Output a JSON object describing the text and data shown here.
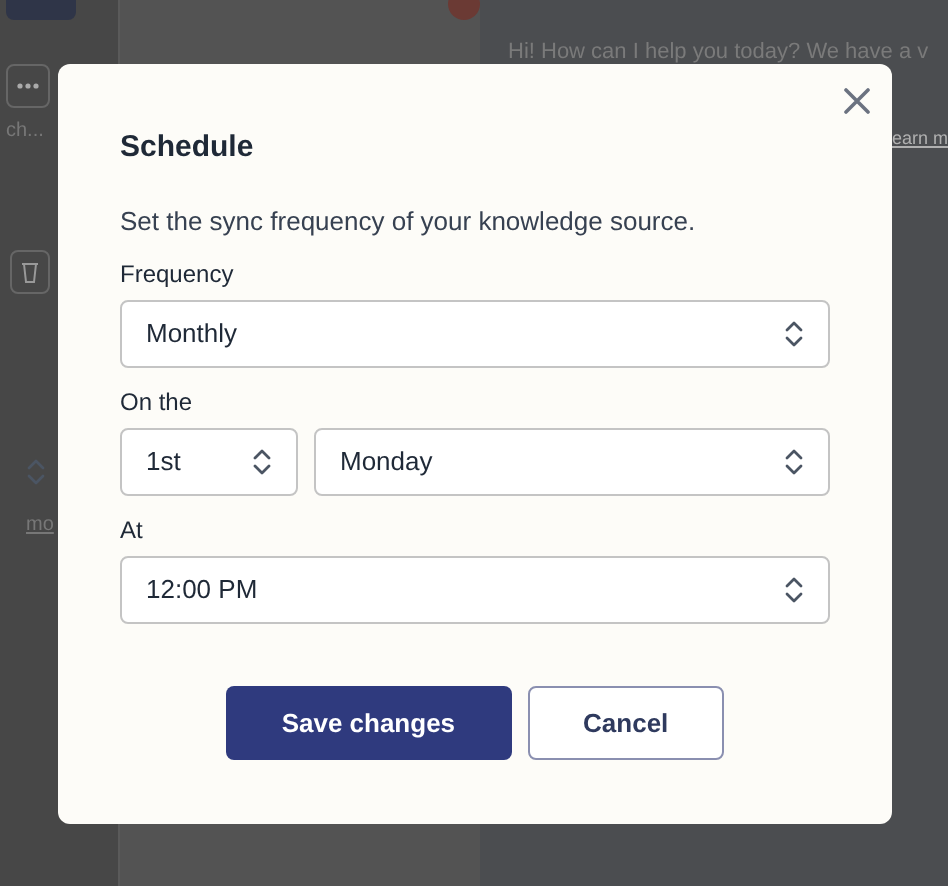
{
  "background": {
    "sidebar_text": "ch...",
    "sidebar_link": "mo",
    "chat_message": "Hi! How can I help you today? We have a v",
    "chat_link": "earn m"
  },
  "dialog": {
    "title": "Schedule",
    "description": "Set the sync frequency of your knowledge source.",
    "rows": [
      {
        "label": "Frequency",
        "selects": [
          {
            "value": "Monthly"
          }
        ]
      },
      {
        "label": "On the",
        "selects": [
          {
            "value": "1st"
          },
          {
            "value": "Monday"
          }
        ]
      },
      {
        "label": "At",
        "selects": [
          {
            "value": "12:00 PM"
          }
        ]
      }
    ],
    "buttons": [
      {
        "label": "Save changes",
        "kind": "primary"
      },
      {
        "label": "Cancel",
        "kind": "secondary"
      }
    ]
  }
}
